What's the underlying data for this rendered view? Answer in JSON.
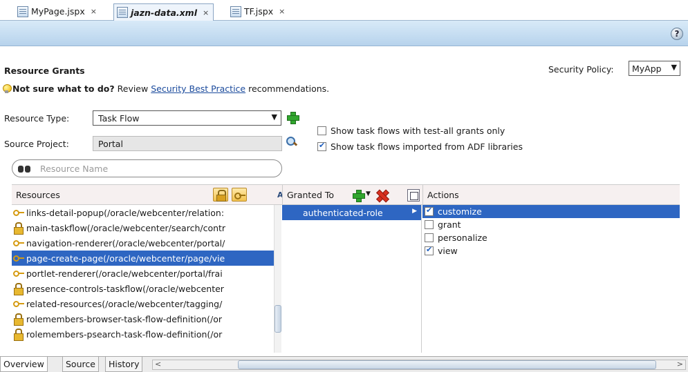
{
  "editor_tabs": [
    {
      "label": "MyPage.jspx",
      "close": "×"
    },
    {
      "label": "jazn-data.xml",
      "close": "×"
    },
    {
      "label": "TF.jspx",
      "close": "×"
    }
  ],
  "help_label": "?",
  "form": {
    "title": "Resource Grants",
    "security_policy_label": "Security Policy:",
    "security_policy_value": "MyApp",
    "hint_bold": "Not sure what to do?",
    "hint_prefix": "Review",
    "hint_link": "Security Best Practice",
    "hint_suffix": "recommendations.",
    "resource_type_label": "Resource Type:",
    "resource_type_value": "Task Flow",
    "source_project_label": "Source Project:",
    "source_project_value": "Portal",
    "checkbox_test_all_label": "Show task flows with test-all grants only",
    "checkbox_test_all_checked": false,
    "checkbox_adf_label": "Show task flows imported from ADF libraries",
    "checkbox_adf_checked": true,
    "search_placeholder": "Resource Name"
  },
  "resources": {
    "header": "Resources",
    "items": [
      {
        "icon": "key-icon",
        "text": "links-detail-popup(/oracle/webcenter/relation:",
        "selected": false
      },
      {
        "icon": "lock-icon",
        "text": "main-taskflow(/oracle/webcenter/search/contr",
        "selected": false
      },
      {
        "icon": "key-icon",
        "text": "navigation-renderer(/oracle/webcenter/portal/",
        "selected": false
      },
      {
        "icon": "key-icon",
        "text": "page-create-page(/oracle/webcenter/page/vie",
        "selected": true
      },
      {
        "icon": "key-icon",
        "text": "portlet-renderer(/oracle/webcenter/portal/frai",
        "selected": false
      },
      {
        "icon": "lock-icon",
        "text": "presence-controls-taskflow(/oracle/webcenter",
        "selected": false
      },
      {
        "icon": "key-icon",
        "text": "related-resources(/oracle/webcenter/tagging/",
        "selected": false
      },
      {
        "icon": "lock-icon",
        "text": "rolemembers-browser-task-flow-definition(/or",
        "selected": false
      },
      {
        "icon": "lock-icon",
        "text": "rolemembers-psearch-task-flow-definition(/or",
        "selected": false
      }
    ]
  },
  "granted_to": {
    "header": "Granted To",
    "items": [
      "authenticated-role"
    ]
  },
  "actions": {
    "header": "Actions",
    "items": [
      {
        "label": "customize",
        "checked": true,
        "selected": true
      },
      {
        "label": "grant",
        "checked": false,
        "selected": false
      },
      {
        "label": "personalize",
        "checked": false,
        "selected": false
      },
      {
        "label": "view",
        "checked": true,
        "selected": false
      }
    ]
  },
  "bottom_tabs": [
    "Overview",
    "Source",
    "History"
  ],
  "colors": {
    "selection": "#2e66c2",
    "band": "#c6def2",
    "link": "#1a4a9c"
  }
}
